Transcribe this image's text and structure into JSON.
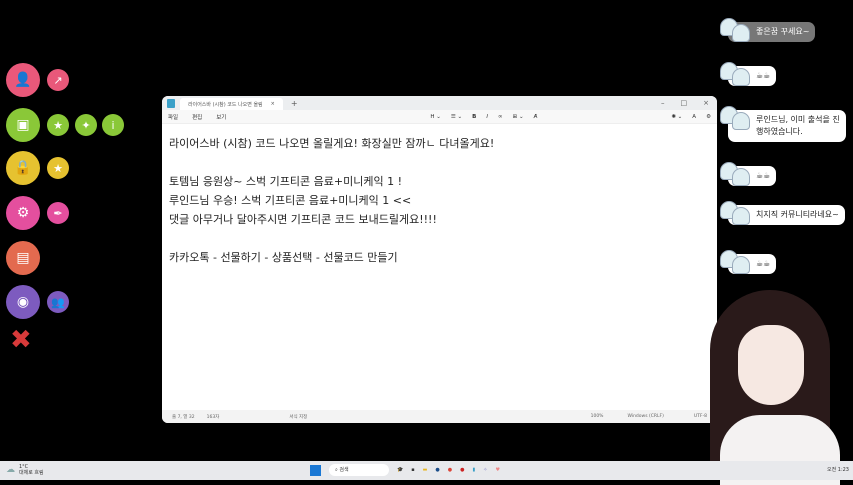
{
  "left_icons": [
    {
      "name": "user",
      "color": "#e9587a",
      "sym": "👤"
    },
    {
      "name": "share",
      "color": "#e9587a",
      "sym": "↗"
    },
    {
      "name": "image",
      "color": "#8ac838",
      "sym": "▣"
    },
    {
      "name": "star",
      "color": "#8ac838",
      "sym": "★"
    },
    {
      "name": "sparkle",
      "color": "#8ac838",
      "sym": "✦"
    },
    {
      "name": "info",
      "color": "#8ac838",
      "sym": "i"
    },
    {
      "name": "lock",
      "color": "#e6c230",
      "sym": "🔒"
    },
    {
      "name": "star2",
      "color": "#e6c230",
      "sym": "★"
    },
    {
      "name": "gear",
      "color": "#e44f9e",
      "sym": "⚙"
    },
    {
      "name": "feather",
      "color": "#e44f9e",
      "sym": "✒"
    },
    {
      "name": "document",
      "color": "#e36a4f",
      "sym": "▤"
    },
    {
      "name": "podcast",
      "color": "#7d5bbf",
      "sym": "◉"
    },
    {
      "name": "group",
      "color": "#7d5bbf",
      "sym": "👥"
    },
    {
      "name": "close",
      "color": "#d83a3a",
      "sym": "✖"
    }
  ],
  "notepad": {
    "tab_title": "라이어스바 (시참) 코드 나오면 올림",
    "menu": [
      "파일",
      "편집",
      "보기"
    ],
    "lines": [
      "라이어스바 (시참) 코드 나오면 올릴게요! 화장실만 잠까ㄴ 다녀올게요!",
      "",
      "토템님 응원상~ 스벅 기프티콘 음료+미니케익 1 !",
      "루인드님 우승! 스벅 기프티콘 음료+미니케익 1 <<",
      "댓글 아무거나 달아주시면 기프티콘 코드 보내드릴게요!!!!",
      "",
      "카카오톡 - 선물하기 - 상품선택 - 선물코드 만들기"
    ],
    "status": {
      "position": "줄 7, 열 32",
      "chars": "163자",
      "format": "서식 지정",
      "zoom": "100%",
      "eol": "Windows (CRLF)",
      "encoding": "UTF-8"
    }
  },
  "chat": [
    "좋은꿈 꾸세요~",
    "☕☕",
    "루인드님, 이미 출석을 진행하였습니다.",
    "☕☕",
    "치지직 커뮤니티라네요~",
    "☕☕"
  ],
  "taskbar": {
    "weather_temp": "1°C",
    "weather_desc": "대체로 흐림",
    "search": "검색",
    "clock": "오전 1:23"
  }
}
